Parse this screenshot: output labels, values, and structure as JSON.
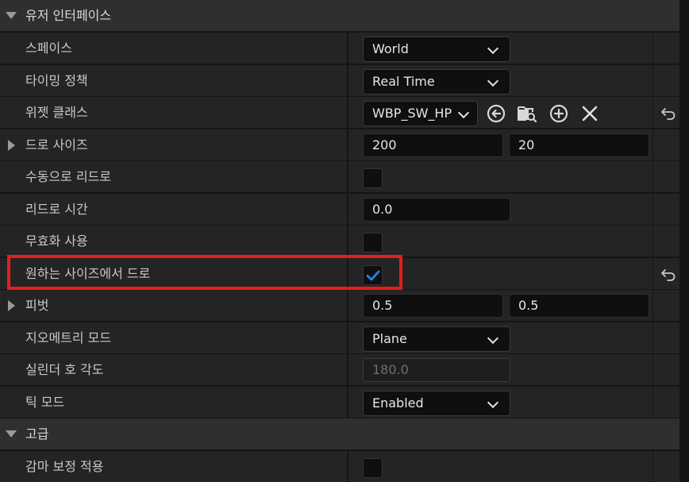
{
  "sections": {
    "user_interface": {
      "title": "유저 인터페이스"
    },
    "advanced": {
      "title": "고급"
    }
  },
  "properties": {
    "space": {
      "label": "스페이스",
      "value": "World"
    },
    "timing_policy": {
      "label": "타이밍 정책",
      "value": "Real Time"
    },
    "widget_class": {
      "label": "위젯 클래스",
      "value": "WBP_SW_HP"
    },
    "draw_size": {
      "label": "드로 사이즈",
      "x": "200",
      "y": "20"
    },
    "manual_redraw": {
      "label": "수동으로 리드로",
      "checked": false
    },
    "redraw_time": {
      "label": "리드로 시간",
      "value": "0.0"
    },
    "disable_rendering": {
      "label": "무효화 사용",
      "checked": false
    },
    "draw_at_desired_size": {
      "label": "원하는 사이즈에서 드로",
      "checked": true
    },
    "pivot": {
      "label": "피벗",
      "x": "0.5",
      "y": "0.5"
    },
    "geometry_mode": {
      "label": "지오메트리 모드",
      "value": "Plane"
    },
    "cylinder_arc_angle": {
      "label": "실린더 호 각도",
      "value": "180.0"
    },
    "tick_mode": {
      "label": "틱 모드",
      "value": "Enabled"
    },
    "apply_gamma_correction": {
      "label": "감마 보정 적용",
      "checked": false
    }
  },
  "icons": {
    "use_selected": "arrow-left-circle-icon",
    "browse": "folder-search-icon",
    "add": "plus-circle-icon",
    "clear": "close-icon",
    "reset": "reset-arrow-icon"
  },
  "colors": {
    "highlight": "#e21e1e",
    "checkmark": "#1e7fe6"
  }
}
